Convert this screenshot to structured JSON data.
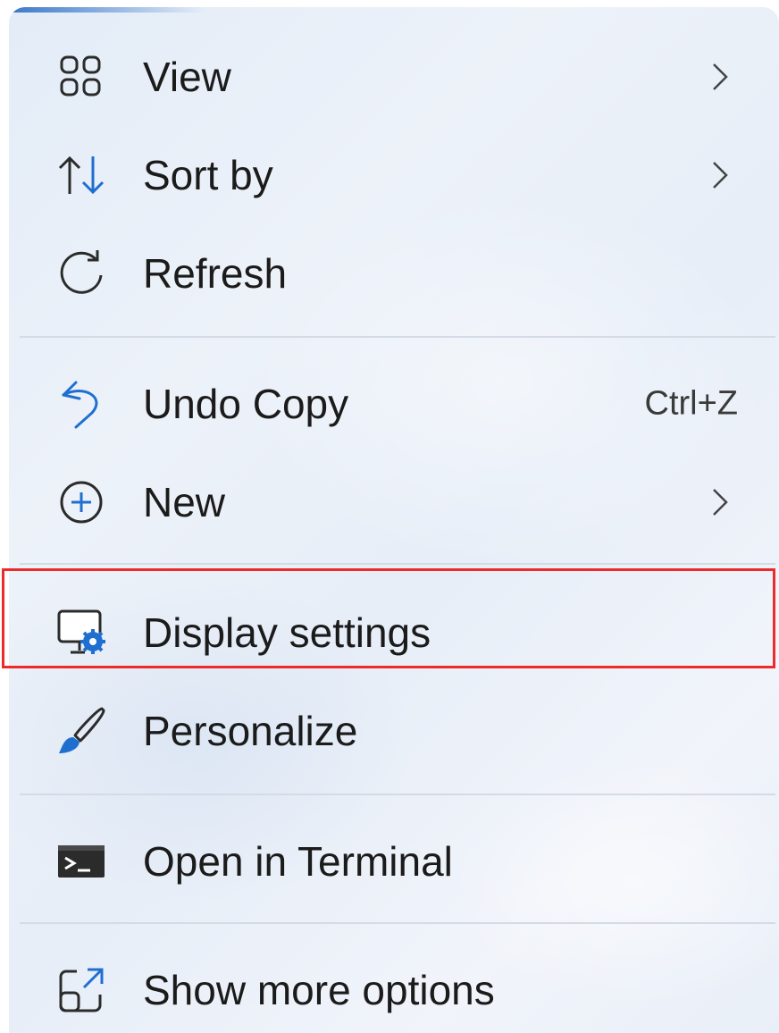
{
  "menu": {
    "items": [
      {
        "id": "view",
        "label": "View",
        "icon": "grid-icon",
        "has_submenu": true
      },
      {
        "id": "sort-by",
        "label": "Sort by",
        "icon": "sort-arrows-icon",
        "has_submenu": true
      },
      {
        "id": "refresh",
        "label": "Refresh",
        "icon": "refresh-icon",
        "has_submenu": false
      },
      {
        "id": "undo-copy",
        "label": "Undo Copy",
        "icon": "undo-icon",
        "shortcut": "Ctrl+Z"
      },
      {
        "id": "new",
        "label": "New",
        "icon": "plus-circle-icon",
        "has_submenu": true
      },
      {
        "id": "display-settings",
        "label": "Display settings",
        "icon": "display-settings-icon",
        "highlighted": true
      },
      {
        "id": "personalize",
        "label": "Personalize",
        "icon": "paintbrush-icon"
      },
      {
        "id": "open-in-terminal",
        "label": "Open in Terminal",
        "icon": "terminal-icon"
      },
      {
        "id": "show-more-options",
        "label": "Show more options",
        "icon": "expand-icon"
      }
    ]
  },
  "colors": {
    "accent_blue": "#1f6fd1",
    "highlight_border": "#ee2b2b",
    "separator": "#d4dbe5",
    "text": "#1b1b1b"
  }
}
